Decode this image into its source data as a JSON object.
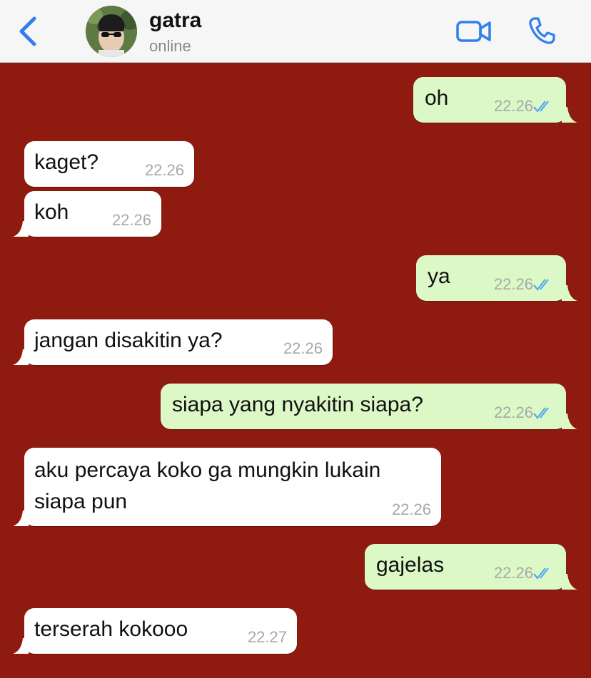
{
  "header": {
    "contact_name": "gatra",
    "status": "online"
  },
  "messages": [
    {
      "text": "oh",
      "time": "22.26",
      "direction": "outgoing",
      "read": true
    },
    {
      "text": "kaget?",
      "time": "22.26",
      "direction": "incoming"
    },
    {
      "text": "koh",
      "time": "22.26",
      "direction": "incoming"
    },
    {
      "text": "ya",
      "time": "22.26",
      "direction": "outgoing",
      "read": true
    },
    {
      "text": "jangan disakitin ya?",
      "time": "22.26",
      "direction": "incoming"
    },
    {
      "text": "siapa yang nyakitin siapa?",
      "time": "22.26",
      "direction": "outgoing",
      "read": true
    },
    {
      "text": "aku percaya koko ga mungkin lukain",
      "text2": "siapa pun",
      "time": "22.26",
      "direction": "incoming"
    },
    {
      "text": "gajelas",
      "time": "22.26",
      "direction": "outgoing",
      "read": true
    },
    {
      "text": "terserah kokooo",
      "time": "22.27",
      "direction": "incoming"
    }
  ],
  "colors": {
    "background": "#8e1a10",
    "incoming_bubble": "#ffffff",
    "outgoing_bubble": "#dcf8c6",
    "accent": "#2f80ed",
    "read_ticks": "#53aaf1"
  },
  "icons": [
    "back-chevron-icon",
    "avatar",
    "video-call-icon",
    "phone-call-icon",
    "double-check-icon"
  ]
}
